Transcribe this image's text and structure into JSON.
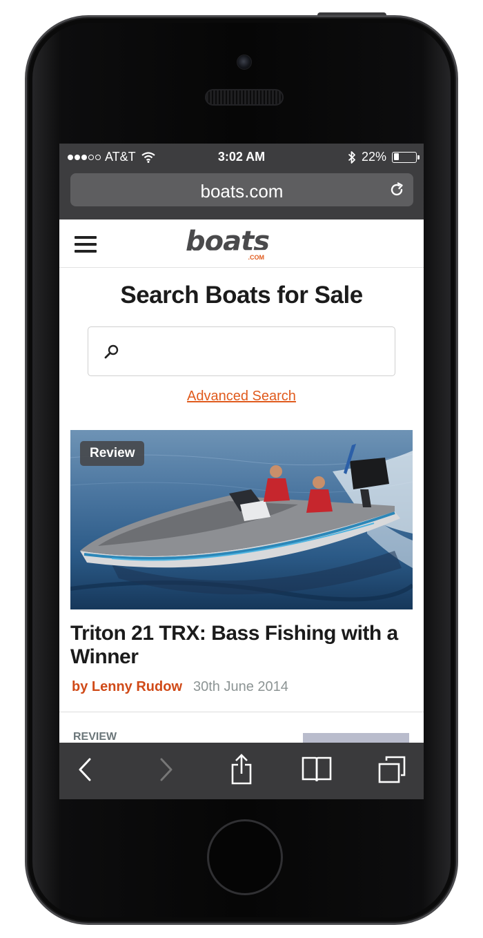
{
  "status_bar": {
    "carrier": "AT&T",
    "time": "3:02 AM",
    "battery": "22%",
    "battery_level": 0.22,
    "signal_bars_filled": 3,
    "signal_bars_total": 5
  },
  "browser": {
    "url": "boats.com"
  },
  "site": {
    "logo_text": "boats",
    "logo_tld": ".COM",
    "accent_color": "#e05a1c"
  },
  "search": {
    "title": "Search Boats for Sale",
    "placeholder": "",
    "advanced_link": "Advanced Search"
  },
  "article": {
    "badge": "Review",
    "title": "Triton 21 TRX: Bass Fishing with a Winner",
    "author": "by Lenny Rudow",
    "date": "30th June 2014"
  },
  "next_article": {
    "category": "REVIEW"
  },
  "toolbar": {
    "icons": [
      "back-icon",
      "forward-icon",
      "share-icon",
      "bookmarks-icon",
      "tabs-icon"
    ]
  }
}
